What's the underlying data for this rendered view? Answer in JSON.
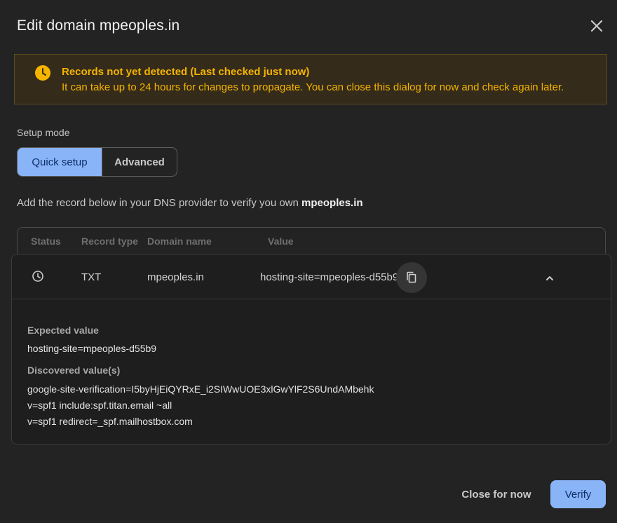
{
  "dialog": {
    "title": "Edit domain mpeoples.in"
  },
  "banner": {
    "title": "Records not yet detected (Last checked just now)",
    "text": "It can take up to 24 hours for changes to propagate. You can close this dialog for now and check again later.",
    "icon": "clock-icon",
    "color": "#f5b400"
  },
  "setup": {
    "label": "Setup mode",
    "options": [
      "Quick setup",
      "Advanced"
    ],
    "selected": "Quick setup"
  },
  "instruction": {
    "prefix": "Add the record below in your DNS provider to verify you own ",
    "domain": "mpeoples.in"
  },
  "table": {
    "headers": [
      "Status",
      "Record type",
      "Domain name",
      "Value"
    ],
    "record": {
      "status_icon": "clock-icon",
      "type": "TXT",
      "domain": "mpeoples.in",
      "value": "hosting-site=mpeoples-d55b9",
      "expanded": true
    }
  },
  "details": {
    "expected_label": "Expected value",
    "expected_value": "hosting-site=mpeoples-d55b9",
    "discovered_label": "Discovered value(s)",
    "discovered_values": [
      "google-site-verification=I5byHjEiQYRxE_i2SIWwUOE3xlGwYlF2S6UndAMbehk",
      "v=spf1 include:spf.titan.email ~all",
      "v=spf1 redirect=_spf.mailhostbox.com"
    ]
  },
  "actions": {
    "close_label": "Close for now",
    "verify_label": "Verify"
  },
  "colors": {
    "accent": "#8ab4f8",
    "background": "#232323",
    "warning": "#f5b400"
  }
}
